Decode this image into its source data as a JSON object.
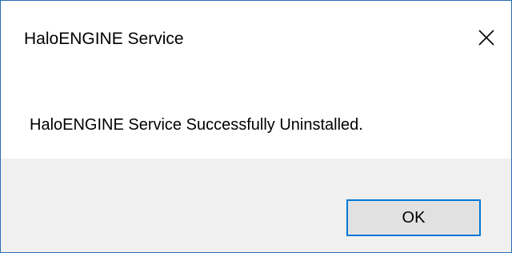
{
  "dialog": {
    "title": "HaloENGINE Service",
    "message": "HaloENGINE Service Successfully Uninstalled.",
    "close_icon": "close-icon",
    "ok_label": "OK"
  },
  "colors": {
    "border": "#2d6db6",
    "footer_bg": "#f0f0f0",
    "button_bg": "#e1e1e1",
    "button_focus": "#0078d7"
  }
}
